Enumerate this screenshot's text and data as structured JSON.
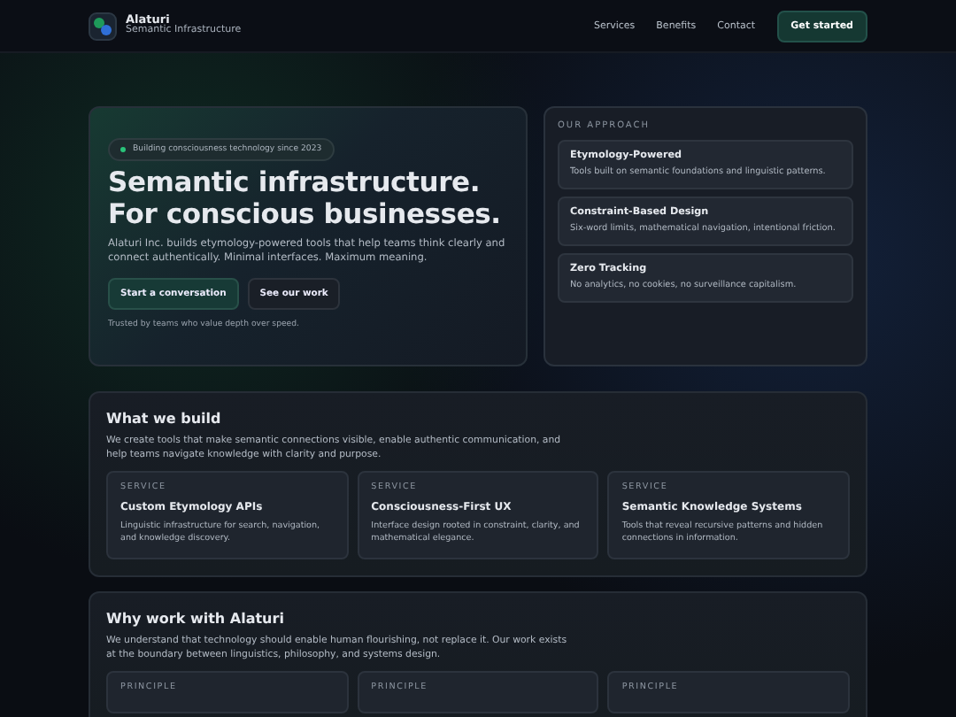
{
  "brand": {
    "name": "Alaturi",
    "tagline": "Semantic Infrastructure"
  },
  "nav": {
    "links": [
      "Services",
      "Benefits",
      "Contact"
    ],
    "cta": "Get started"
  },
  "hero": {
    "badge": "Building consciousness technology since 2023",
    "title_lines": [
      "Semantic infrastructure.",
      "For conscious businesses."
    ],
    "lead": "Alaturi Inc. builds etymology-powered tools that help teams think clearly and connect authentically. Minimal interfaces. Maximum meaning.",
    "buttons": [
      {
        "label": "Start a conversation",
        "kind": "primary"
      },
      {
        "label": "See our work",
        "kind": "secondary"
      }
    ],
    "note": "Trusted by teams who value depth over speed."
  },
  "approach": {
    "heading": "OUR APPROACH",
    "items": [
      {
        "title": "Etymology-Powered",
        "text": "Tools built on semantic foundations and linguistic patterns."
      },
      {
        "title": "Constraint-Based Design",
        "text": "Six-word limits, mathematical navigation, intentional friction."
      },
      {
        "title": "Zero Tracking",
        "text": "No analytics, no cookies, no surveillance capitalism."
      }
    ]
  },
  "sections": [
    {
      "title": "What we build",
      "text": "We create tools that make semantic connections visible, enable authentic communication, and help teams navigate knowledge with clarity and purpose.",
      "cards": [
        {
          "label": "SERVICE",
          "title": "Custom Etymology APIs",
          "text": "Linguistic infrastructure for search, navigation, and knowledge discovery."
        },
        {
          "label": "SERVICE",
          "title": "Consciousness-First UX",
          "text": "Interface design rooted in constraint, clarity, and mathematical elegance."
        },
        {
          "label": "SERVICE",
          "title": "Semantic Knowledge Systems",
          "text": "Tools that reveal recursive patterns and hidden connections in information."
        }
      ]
    },
    {
      "title": "Why work with Alaturi",
      "text": "We understand that technology should enable human flourishing, not replace it. Our work exists at the boundary between linguistics, philosophy, and systems design.",
      "cards": [
        {
          "label": "PRINCIPLE"
        },
        {
          "label": "PRINCIPLE"
        },
        {
          "label": "PRINCIPLE"
        }
      ]
    }
  ]
}
